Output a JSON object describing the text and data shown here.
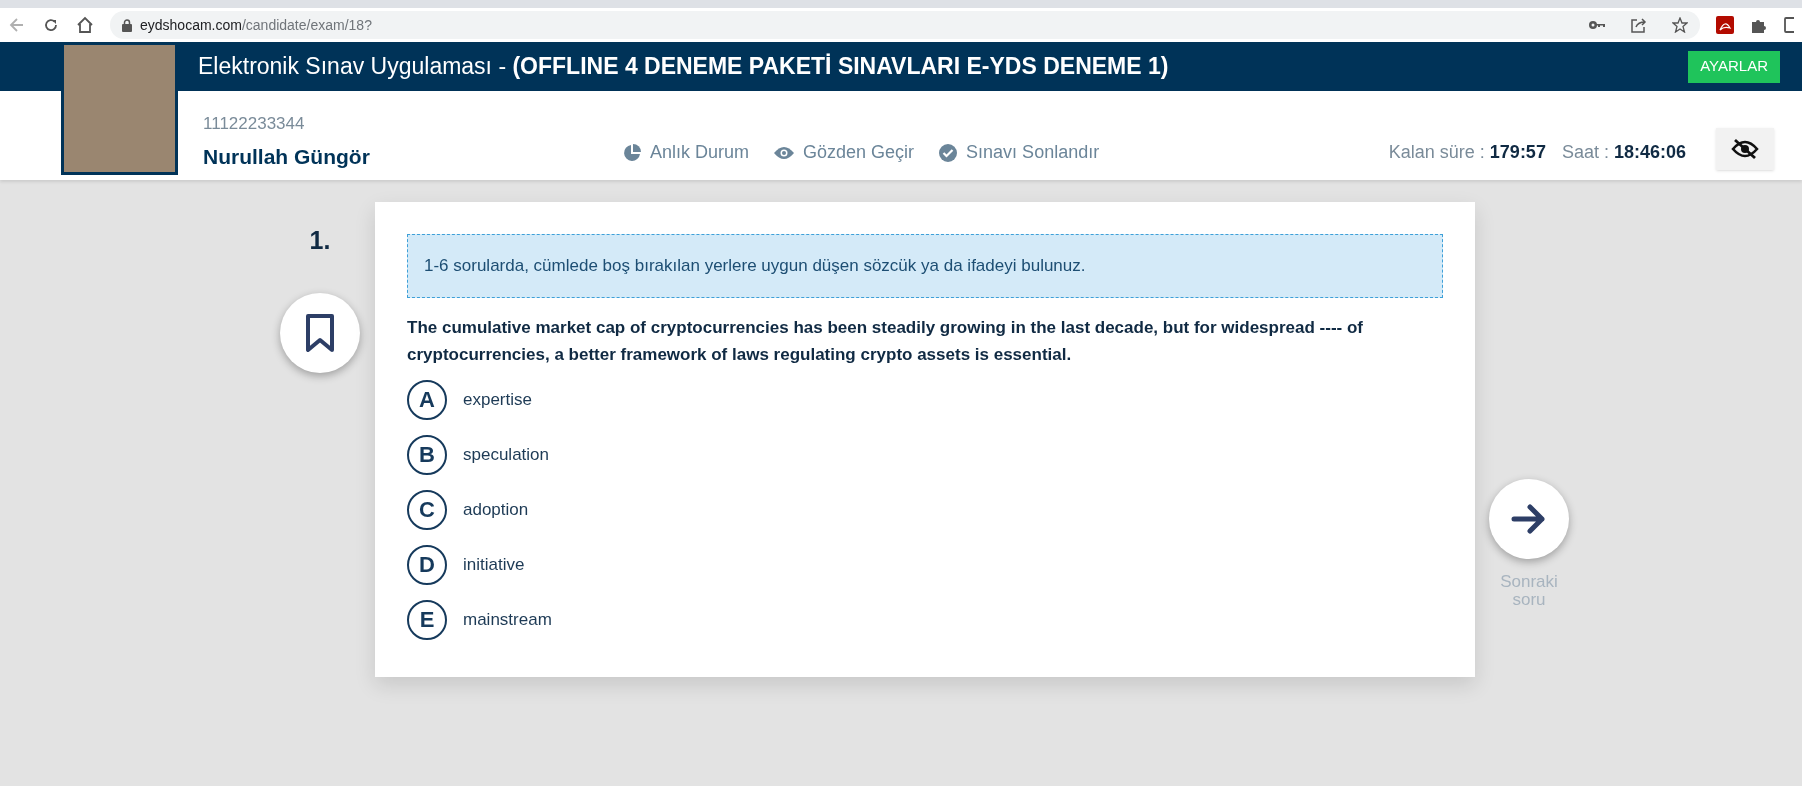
{
  "browser": {
    "url_host": "eydshocam.com",
    "url_path": "/candidate/exam/18?"
  },
  "header": {
    "title": "Elektronik Sınav Uygulaması - ",
    "exam_name": "(OFFLINE 4 DENEME PAKETİ SINAVLARI E-YDS DENEME 1)",
    "settings_button": "AYARLAR"
  },
  "candidate": {
    "id": "11122233344",
    "name": "Nurullah Güngör"
  },
  "nav": [
    {
      "kind": "status",
      "label": "Anlık Durum"
    },
    {
      "kind": "review",
      "label": "Gözden Geçir"
    },
    {
      "kind": "finish",
      "label": "Sınavı Sonlandır"
    }
  ],
  "timer": {
    "remaining_label": "Kalan süre :",
    "remaining": "179:57",
    "clock_label": "Saat :",
    "clock": "18:46:06"
  },
  "question": {
    "number": "1.",
    "instruction": "1-6 sorularda, cümlede boş bırakılan yerlere uygun düşen sözcük ya da ifadeyi bulunuz.",
    "text": "The cumulative market cap of cryptocurrencies has been steadily growing in the last decade, but for widespread ---- of cryptocurrencies, a better framework of laws regulating crypto assets is essential.",
    "options": [
      {
        "letter": "A",
        "text": "expertise"
      },
      {
        "letter": "B",
        "text": "speculation"
      },
      {
        "letter": "C",
        "text": "adoption"
      },
      {
        "letter": "D",
        "text": "initiative"
      },
      {
        "letter": "E",
        "text": "mainstream"
      }
    ]
  },
  "next_button": {
    "line_1": "Sonraki",
    "line_2": "soru"
  }
}
